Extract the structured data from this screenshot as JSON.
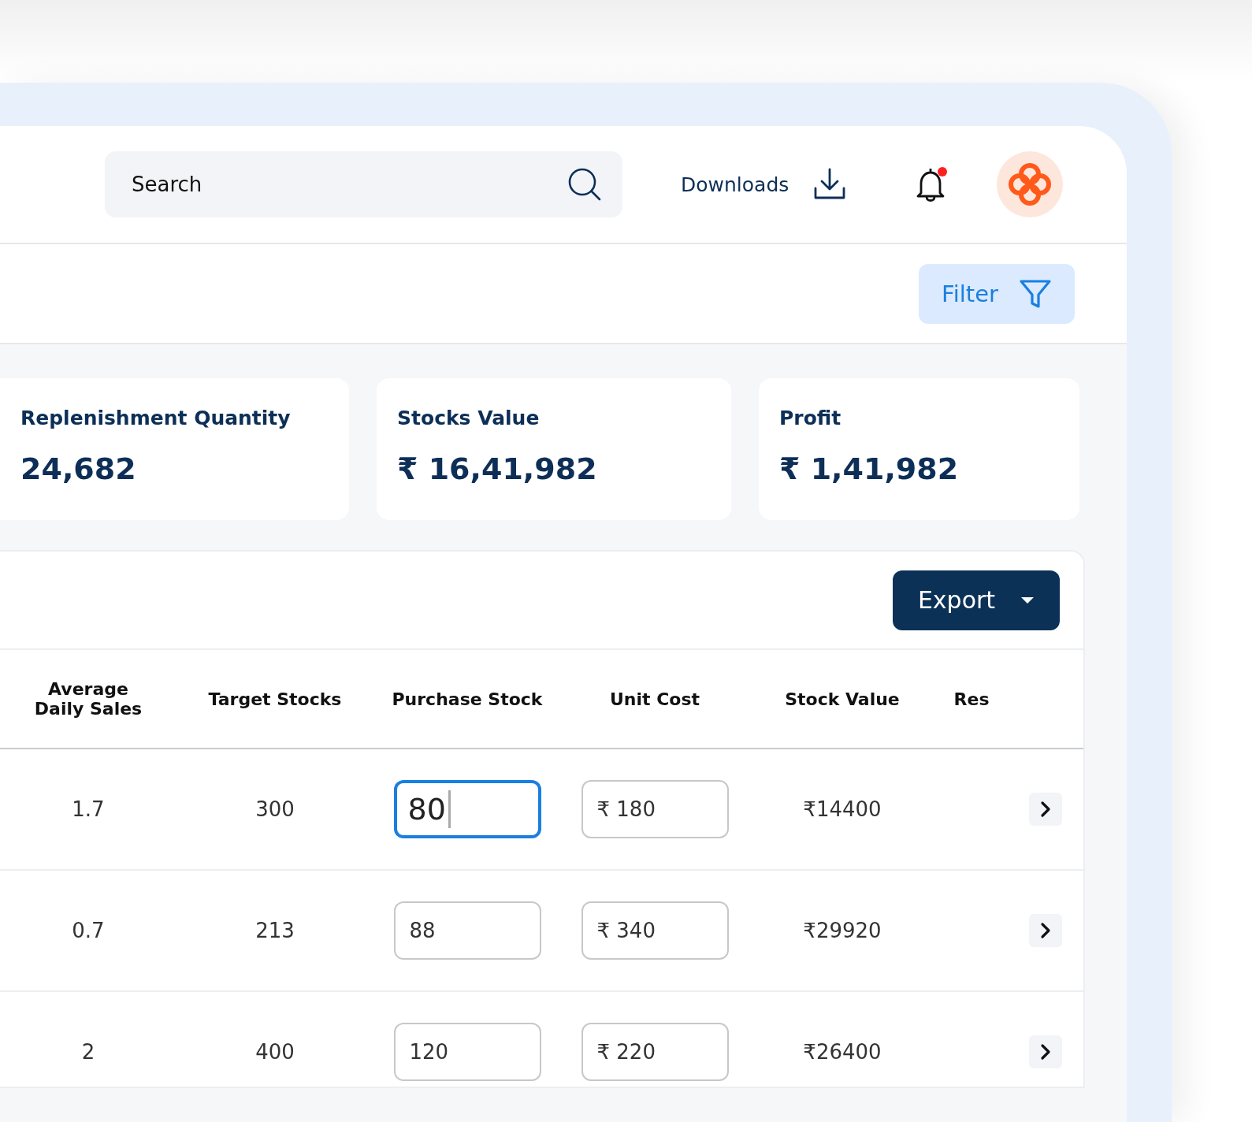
{
  "search": {
    "placeholder": "Search"
  },
  "downloads": {
    "label": "Downloads"
  },
  "notifications": {
    "unread": true
  },
  "filter": {
    "label": "Filter"
  },
  "stats": [
    {
      "label": "Replenishment Quantity",
      "value": "24,682"
    },
    {
      "label": "Stocks Value",
      "value": "₹ 16,41,982"
    },
    {
      "label": "Profit",
      "value": "₹ 1,41,982"
    }
  ],
  "export": {
    "label": "Export"
  },
  "table": {
    "columns": [
      "Average Daily Sales",
      "Target Stocks",
      "Purchase Stock",
      "Unit Cost",
      "Stock Value",
      "Res"
    ],
    "rows": [
      {
        "average_daily_sales": "1.7",
        "target_stocks": "300",
        "purchase_stock": "80",
        "focused": true,
        "unit_cost": "₹ 180",
        "stock_value": "₹14400"
      },
      {
        "average_daily_sales": "0.7",
        "target_stocks": "213",
        "purchase_stock": "88",
        "focused": false,
        "unit_cost": "₹ 340",
        "stock_value": "₹29920"
      },
      {
        "average_daily_sales": "2",
        "target_stocks": "400",
        "purchase_stock": "120",
        "focused": false,
        "unit_cost": "₹ 220",
        "stock_value": "₹26400"
      }
    ]
  }
}
